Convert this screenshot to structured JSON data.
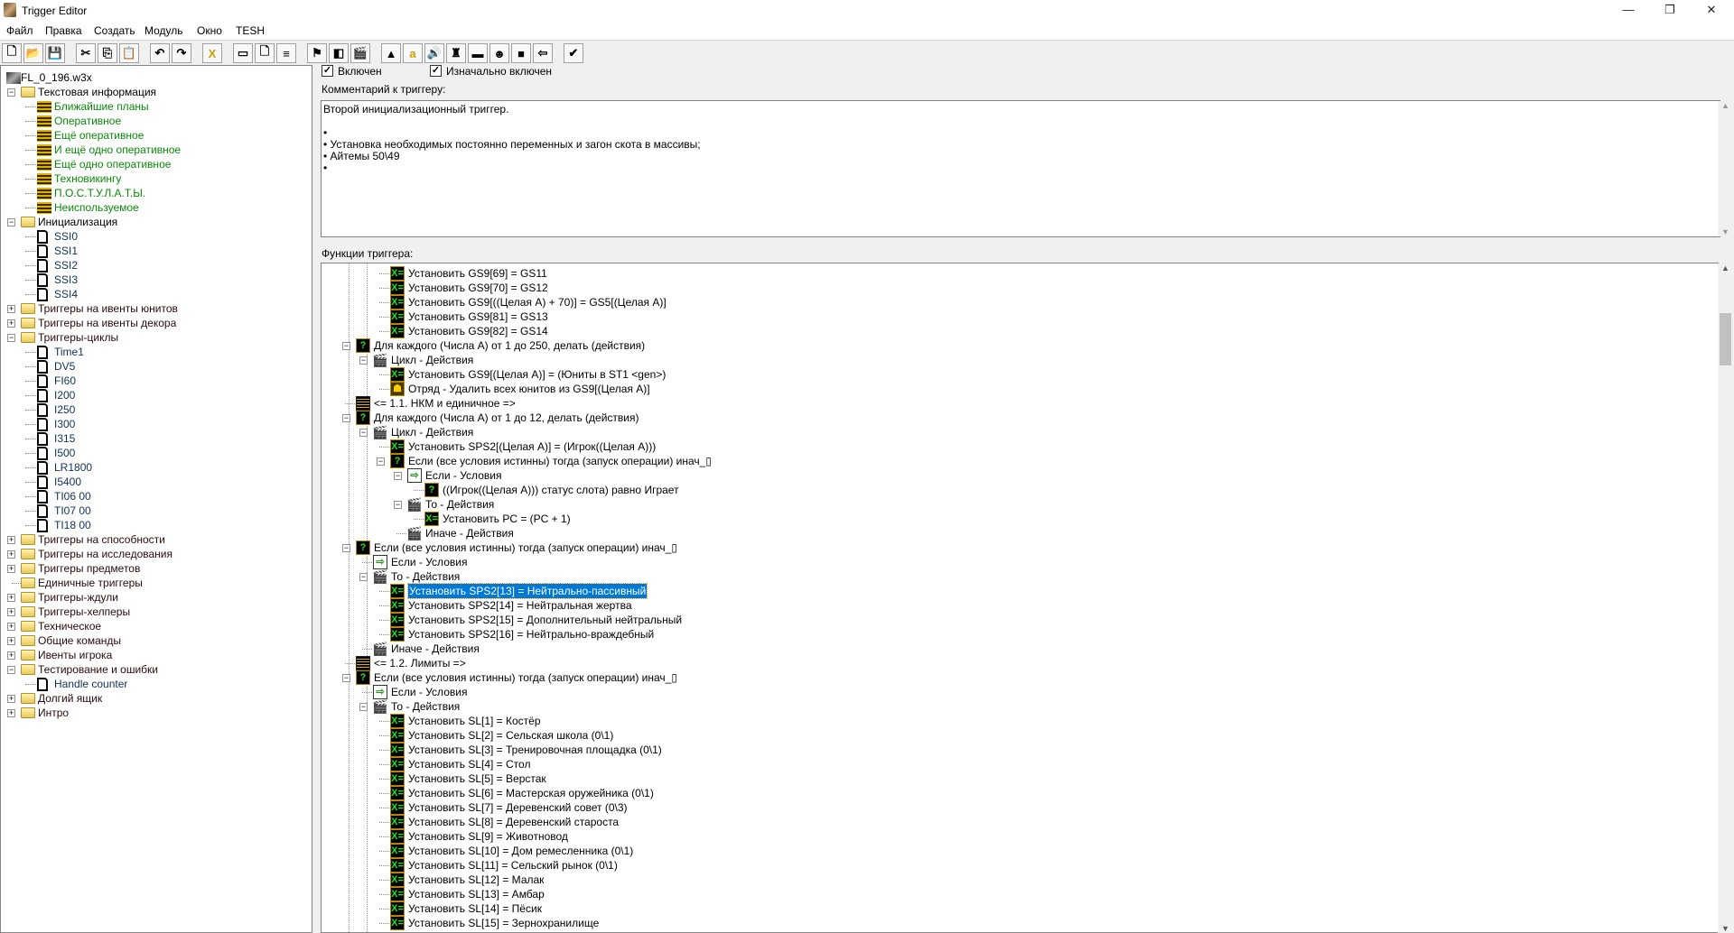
{
  "window": {
    "title": "Trigger Editor",
    "minimize": "—",
    "maximize": "❐",
    "close": "✕"
  },
  "menu": [
    "Файл",
    "Правка",
    "Создать",
    "Модуль",
    "Окно",
    "TESH"
  ],
  "toolbar": [
    {
      "name": "new",
      "glyph": "🗋"
    },
    {
      "name": "open",
      "glyph": "📂"
    },
    {
      "name": "save",
      "glyph": "💾"
    },
    {
      "name": "cut",
      "glyph": "✂"
    },
    {
      "name": "copy",
      "glyph": "⎘"
    },
    {
      "name": "paste",
      "glyph": "📋"
    },
    {
      "name": "undo",
      "glyph": "↶"
    },
    {
      "name": "redo",
      "glyph": "↷"
    },
    {
      "name": "delete",
      "glyph": "X"
    },
    {
      "name": "new-category",
      "glyph": "▭"
    },
    {
      "name": "new-trigger",
      "glyph": "🗋"
    },
    {
      "name": "new-comment",
      "glyph": "≡"
    },
    {
      "name": "new-event",
      "glyph": "⚑"
    },
    {
      "name": "new-condition",
      "glyph": "◧"
    },
    {
      "name": "new-action",
      "glyph": "🎬"
    },
    {
      "name": "terrain-editor",
      "glyph": "▲"
    },
    {
      "name": "trigger-editor",
      "glyph": "a"
    },
    {
      "name": "sound-editor",
      "glyph": "🔊"
    },
    {
      "name": "object-editor",
      "glyph": "♜"
    },
    {
      "name": "campaign-editor",
      "glyph": "▬"
    },
    {
      "name": "ai-editor",
      "glyph": "☻"
    },
    {
      "name": "object-manager",
      "glyph": "■"
    },
    {
      "name": "import-manager",
      "glyph": "⇦"
    },
    {
      "name": "test-map",
      "glyph": "✔"
    }
  ],
  "left_tree": [
    {
      "level": 0,
      "icon": "map",
      "text": "FL_0_196.w3x",
      "color": "#000"
    },
    {
      "level": 1,
      "icon": "folder",
      "exp": "−",
      "text": "Текстовая информация",
      "color": "#000"
    },
    {
      "level": 2,
      "icon": "comment",
      "text": "Ближайшие планы",
      "color": "#0a8a0a"
    },
    {
      "level": 2,
      "icon": "comment",
      "text": "Оперативное",
      "color": "#0a8a0a"
    },
    {
      "level": 2,
      "icon": "comment",
      "text": "Ещё оперативное",
      "color": "#0a8a0a"
    },
    {
      "level": 2,
      "icon": "comment",
      "text": "И ещё одно оперативное",
      "color": "#0a8a0a"
    },
    {
      "level": 2,
      "icon": "comment",
      "text": "Ещё одно оперативное",
      "color": "#0a8a0a"
    },
    {
      "level": 2,
      "icon": "comment",
      "text": "Техновикингу",
      "color": "#0a8a0a"
    },
    {
      "level": 2,
      "icon": "comment",
      "text": "П.О.С.Т.У.Л.А.Т.Ы.",
      "color": "#0a8a0a"
    },
    {
      "level": 2,
      "icon": "comment",
      "text": "Неиспользуемое",
      "color": "#0a8a0a"
    },
    {
      "level": 1,
      "icon": "folder",
      "exp": "−",
      "text": "Инициализация",
      "color": "#000"
    },
    {
      "level": 2,
      "icon": "doc",
      "text": "SSI0",
      "color": "#10305a"
    },
    {
      "level": 2,
      "icon": "doc",
      "text": "SSI1",
      "color": "#10305a"
    },
    {
      "level": 2,
      "icon": "doc",
      "text": "SSI2",
      "color": "#10305a"
    },
    {
      "level": 2,
      "icon": "doc",
      "text": "SSI3",
      "color": "#10305a"
    },
    {
      "level": 2,
      "icon": "doc",
      "text": "SSI4",
      "color": "#10305a"
    },
    {
      "level": 1,
      "icon": "folder",
      "exp": "+",
      "text": "Триггеры на ивенты юнитов",
      "color": "#2a0a0a"
    },
    {
      "level": 1,
      "icon": "folder",
      "exp": "+",
      "text": "Триггеры на ивенты декора",
      "color": "#2a0a0a"
    },
    {
      "level": 1,
      "icon": "folder",
      "exp": "−",
      "text": "Триггеры-циклы",
      "color": "#2a0a0a"
    },
    {
      "level": 2,
      "icon": "doc",
      "text": "Time1",
      "color": "#10305a"
    },
    {
      "level": 2,
      "icon": "doc",
      "text": "DV5",
      "color": "#10305a"
    },
    {
      "level": 2,
      "icon": "doc",
      "text": "FI60",
      "color": "#10305a"
    },
    {
      "level": 2,
      "icon": "doc",
      "text": "I200",
      "color": "#10305a"
    },
    {
      "level": 2,
      "icon": "doc",
      "text": "I250",
      "color": "#10305a"
    },
    {
      "level": 2,
      "icon": "doc",
      "text": "I300",
      "color": "#10305a"
    },
    {
      "level": 2,
      "icon": "doc",
      "text": "I315",
      "color": "#10305a"
    },
    {
      "level": 2,
      "icon": "doc",
      "text": "I500",
      "color": "#10305a"
    },
    {
      "level": 2,
      "icon": "doc",
      "text": "LR1800",
      "color": "#10305a"
    },
    {
      "level": 2,
      "icon": "doc",
      "text": "I5400",
      "color": "#10305a"
    },
    {
      "level": 2,
      "icon": "doc",
      "text": "TI06 00",
      "color": "#10305a"
    },
    {
      "level": 2,
      "icon": "doc",
      "text": "TI07 00",
      "color": "#10305a"
    },
    {
      "level": 2,
      "icon": "doc",
      "text": "TI18 00",
      "color": "#10305a"
    },
    {
      "level": 1,
      "icon": "folder",
      "exp": "+",
      "text": "Триггеры на способности",
      "color": "#2a0a0a"
    },
    {
      "level": 1,
      "icon": "folder",
      "exp": "+",
      "text": "Триггеры на исследования",
      "color": "#2a0a0a"
    },
    {
      "level": 1,
      "icon": "folder",
      "exp": "+",
      "text": "Триггеры предметов",
      "color": "#2a0a0a"
    },
    {
      "level": 1,
      "icon": "folder",
      "text": "Единичные триггеры",
      "color": "#2a0a0a"
    },
    {
      "level": 1,
      "icon": "folder",
      "exp": "+",
      "text": "Триггеры-ждули",
      "color": "#2a0a0a"
    },
    {
      "level": 1,
      "icon": "folder",
      "exp": "+",
      "text": "Триггеры-хелперы",
      "color": "#2a0a0a"
    },
    {
      "level": 1,
      "icon": "folder",
      "exp": "+",
      "text": "Техническое",
      "color": "#2a0a0a"
    },
    {
      "level": 1,
      "icon": "folder",
      "exp": "+",
      "text": "Общие команды",
      "color": "#2a0a0a"
    },
    {
      "level": 1,
      "icon": "folder",
      "exp": "+",
      "text": "Ивенты игрока",
      "color": "#2a0a0a"
    },
    {
      "level": 1,
      "icon": "folder",
      "exp": "−",
      "text": "Тестирование и ошибки",
      "color": "#2a0a0a"
    },
    {
      "level": 2,
      "icon": "doc",
      "text": "Handle counter",
      "color": "#10305a"
    },
    {
      "level": 1,
      "icon": "folder",
      "exp": "+",
      "text": "Долгий ящик",
      "color": "#2a0a0a"
    },
    {
      "level": 1,
      "icon": "folder",
      "exp": "+",
      "text": "Интро",
      "color": "#2a0a0a"
    }
  ],
  "trigger": {
    "enabled_label": "Включен",
    "enabled": true,
    "initially_on_label": "Изначально включен",
    "initially_on": true,
    "comment_label": "Комментарий к триггеру:",
    "comment_lines": [
      "Второй инициализационный триггер.",
      "",
      "•",
      "• Установка необходимых постоянно переменных и загон скота в массивы;",
      "• Айтемы 50\\49",
      "•"
    ],
    "functions_label": "Функции триггера:"
  },
  "functions": [
    {
      "level": 3,
      "icon": "set",
      "text": "Установить GS9[69] = GS11"
    },
    {
      "level": 3,
      "icon": "set",
      "text": "Установить GS9[70] = GS12"
    },
    {
      "level": 3,
      "icon": "set",
      "text": "Установить GS9[((Целая A) + 70)] = GS5[(Целая A)]"
    },
    {
      "level": 3,
      "icon": "set",
      "text": "Установить GS9[81] = GS13"
    },
    {
      "level": 3,
      "icon": "set",
      "text": "Установить GS9[82] = GS14"
    },
    {
      "level": 1,
      "icon": "if",
      "exp": "−",
      "text": "Для каждого (Числа A) от 1 до 250, делать (действия)"
    },
    {
      "level": 2,
      "icon": "act",
      "exp": "−",
      "text": "Цикл - Действия"
    },
    {
      "level": 3,
      "icon": "set",
      "text": "Установить GS9[(Целая A)] = (Юниты в ST1 <gen>)"
    },
    {
      "level": 3,
      "icon": "unit",
      "text": "Отряд - Удалить всех юнитов из GS9[(Целая A)]"
    },
    {
      "level": 1,
      "icon": "cmt",
      "text": "<= 1.1. НКМ и единичное =>"
    },
    {
      "level": 1,
      "icon": "if",
      "exp": "−",
      "text": "Для каждого (Числа A) от 1 до 12, делать (действия)"
    },
    {
      "level": 2,
      "icon": "act",
      "exp": "−",
      "text": "Цикл - Действия"
    },
    {
      "level": 3,
      "icon": "set",
      "text": "Установить SPS2[(Целая A)] = (Игрок((Целая A)))"
    },
    {
      "level": 3,
      "icon": "if",
      "exp": "−",
      "text": "Если (все условия истинны) тогда (запуск операции) инач_▯"
    },
    {
      "level": 4,
      "icon": "cond",
      "exp": "−",
      "text": "Если - Условия"
    },
    {
      "level": 5,
      "icon": "if",
      "text": "((Игрок((Целая A))) статус слота) равно Играет"
    },
    {
      "level": 4,
      "icon": "act",
      "exp": "−",
      "text": "То - Действия"
    },
    {
      "level": 5,
      "icon": "set",
      "text": "Установить PC = (PC + 1)"
    },
    {
      "level": 4,
      "icon": "act",
      "text": "Иначе - Действия"
    },
    {
      "level": 1,
      "icon": "if",
      "exp": "−",
      "text": "Если (все условия истинны) тогда (запуск операции) инач_▯"
    },
    {
      "level": 2,
      "icon": "cond",
      "text": "Если - Условия"
    },
    {
      "level": 2,
      "icon": "act",
      "exp": "−",
      "text": "То - Действия"
    },
    {
      "level": 3,
      "icon": "set",
      "text": "Установить SPS2[13] = Нейтрально-пассивный",
      "selected": true
    },
    {
      "level": 3,
      "icon": "set",
      "text": "Установить SPS2[14] = Нейтральная жертва"
    },
    {
      "level": 3,
      "icon": "set",
      "text": "Установить SPS2[15] = Дополнительный нейтральный"
    },
    {
      "level": 3,
      "icon": "set",
      "text": "Установить SPS2[16] = Нейтрально-враждебный"
    },
    {
      "level": 2,
      "icon": "act",
      "text": "Иначе - Действия"
    },
    {
      "level": 1,
      "icon": "cmt",
      "text": "<= 1.2. Лимиты =>"
    },
    {
      "level": 1,
      "icon": "if",
      "exp": "−",
      "text": "Если (все условия истинны) тогда (запуск операции) инач_▯"
    },
    {
      "level": 2,
      "icon": "cond",
      "text": "Если - Условия"
    },
    {
      "level": 2,
      "icon": "act",
      "exp": "−",
      "text": "То - Действия"
    },
    {
      "level": 3,
      "icon": "set",
      "text": "Установить SL[1] = Костёр"
    },
    {
      "level": 3,
      "icon": "set",
      "text": "Установить SL[2] = Сельская школа (0\\1)"
    },
    {
      "level": 3,
      "icon": "set",
      "text": "Установить SL[3] = Тренировочная площадка (0\\1)"
    },
    {
      "level": 3,
      "icon": "set",
      "text": "Установить SL[4] = Стол"
    },
    {
      "level": 3,
      "icon": "set",
      "text": "Установить SL[5] = Верстак"
    },
    {
      "level": 3,
      "icon": "set",
      "text": "Установить SL[6] = Мастерская оружейника (0\\1)"
    },
    {
      "level": 3,
      "icon": "set",
      "text": "Установить SL[7] = Деревенский совет (0\\3)"
    },
    {
      "level": 3,
      "icon": "set",
      "text": "Установить SL[8] = Деревенский староста"
    },
    {
      "level": 3,
      "icon": "set",
      "text": "Установить SL[9] = Животновод"
    },
    {
      "level": 3,
      "icon": "set",
      "text": "Установить SL[10] = Дом ремесленника (0\\1)"
    },
    {
      "level": 3,
      "icon": "set",
      "text": "Установить SL[11] = Сельский рынок (0\\1)"
    },
    {
      "level": 3,
      "icon": "set",
      "text": "Установить SL[12] = Малак"
    },
    {
      "level": 3,
      "icon": "set",
      "text": "Установить SL[13] = Амбар"
    },
    {
      "level": 3,
      "icon": "set",
      "text": "Установить SL[14] = Пёсик"
    },
    {
      "level": 3,
      "icon": "set",
      "text": "Установить SL[15] = Зернохранилище"
    }
  ]
}
